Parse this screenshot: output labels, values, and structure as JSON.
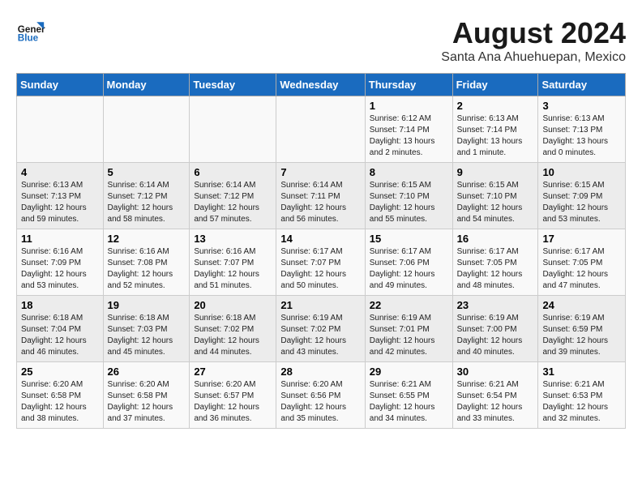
{
  "logo": {
    "line1": "General",
    "line2": "Blue"
  },
  "title": "August 2024",
  "subtitle": "Santa Ana Ahuehuepan, Mexico",
  "days_of_week": [
    "Sunday",
    "Monday",
    "Tuesday",
    "Wednesday",
    "Thursday",
    "Friday",
    "Saturday"
  ],
  "weeks": [
    [
      {
        "day": "",
        "sunrise": "",
        "sunset": "",
        "daylight": ""
      },
      {
        "day": "",
        "sunrise": "",
        "sunset": "",
        "daylight": ""
      },
      {
        "day": "",
        "sunrise": "",
        "sunset": "",
        "daylight": ""
      },
      {
        "day": "",
        "sunrise": "",
        "sunset": "",
        "daylight": ""
      },
      {
        "day": "1",
        "sunrise": "Sunrise: 6:12 AM",
        "sunset": "Sunset: 7:14 PM",
        "daylight": "Daylight: 13 hours and 2 minutes."
      },
      {
        "day": "2",
        "sunrise": "Sunrise: 6:13 AM",
        "sunset": "Sunset: 7:14 PM",
        "daylight": "Daylight: 13 hours and 1 minute."
      },
      {
        "day": "3",
        "sunrise": "Sunrise: 6:13 AM",
        "sunset": "Sunset: 7:13 PM",
        "daylight": "Daylight: 13 hours and 0 minutes."
      }
    ],
    [
      {
        "day": "4",
        "sunrise": "Sunrise: 6:13 AM",
        "sunset": "Sunset: 7:13 PM",
        "daylight": "Daylight: 12 hours and 59 minutes."
      },
      {
        "day": "5",
        "sunrise": "Sunrise: 6:14 AM",
        "sunset": "Sunset: 7:12 PM",
        "daylight": "Daylight: 12 hours and 58 minutes."
      },
      {
        "day": "6",
        "sunrise": "Sunrise: 6:14 AM",
        "sunset": "Sunset: 7:12 PM",
        "daylight": "Daylight: 12 hours and 57 minutes."
      },
      {
        "day": "7",
        "sunrise": "Sunrise: 6:14 AM",
        "sunset": "Sunset: 7:11 PM",
        "daylight": "Daylight: 12 hours and 56 minutes."
      },
      {
        "day": "8",
        "sunrise": "Sunrise: 6:15 AM",
        "sunset": "Sunset: 7:10 PM",
        "daylight": "Daylight: 12 hours and 55 minutes."
      },
      {
        "day": "9",
        "sunrise": "Sunrise: 6:15 AM",
        "sunset": "Sunset: 7:10 PM",
        "daylight": "Daylight: 12 hours and 54 minutes."
      },
      {
        "day": "10",
        "sunrise": "Sunrise: 6:15 AM",
        "sunset": "Sunset: 7:09 PM",
        "daylight": "Daylight: 12 hours and 53 minutes."
      }
    ],
    [
      {
        "day": "11",
        "sunrise": "Sunrise: 6:16 AM",
        "sunset": "Sunset: 7:09 PM",
        "daylight": "Daylight: 12 hours and 53 minutes."
      },
      {
        "day": "12",
        "sunrise": "Sunrise: 6:16 AM",
        "sunset": "Sunset: 7:08 PM",
        "daylight": "Daylight: 12 hours and 52 minutes."
      },
      {
        "day": "13",
        "sunrise": "Sunrise: 6:16 AM",
        "sunset": "Sunset: 7:07 PM",
        "daylight": "Daylight: 12 hours and 51 minutes."
      },
      {
        "day": "14",
        "sunrise": "Sunrise: 6:17 AM",
        "sunset": "Sunset: 7:07 PM",
        "daylight": "Daylight: 12 hours and 50 minutes."
      },
      {
        "day": "15",
        "sunrise": "Sunrise: 6:17 AM",
        "sunset": "Sunset: 7:06 PM",
        "daylight": "Daylight: 12 hours and 49 minutes."
      },
      {
        "day": "16",
        "sunrise": "Sunrise: 6:17 AM",
        "sunset": "Sunset: 7:05 PM",
        "daylight": "Daylight: 12 hours and 48 minutes."
      },
      {
        "day": "17",
        "sunrise": "Sunrise: 6:17 AM",
        "sunset": "Sunset: 7:05 PM",
        "daylight": "Daylight: 12 hours and 47 minutes."
      }
    ],
    [
      {
        "day": "18",
        "sunrise": "Sunrise: 6:18 AM",
        "sunset": "Sunset: 7:04 PM",
        "daylight": "Daylight: 12 hours and 46 minutes."
      },
      {
        "day": "19",
        "sunrise": "Sunrise: 6:18 AM",
        "sunset": "Sunset: 7:03 PM",
        "daylight": "Daylight: 12 hours and 45 minutes."
      },
      {
        "day": "20",
        "sunrise": "Sunrise: 6:18 AM",
        "sunset": "Sunset: 7:02 PM",
        "daylight": "Daylight: 12 hours and 44 minutes."
      },
      {
        "day": "21",
        "sunrise": "Sunrise: 6:19 AM",
        "sunset": "Sunset: 7:02 PM",
        "daylight": "Daylight: 12 hours and 43 minutes."
      },
      {
        "day": "22",
        "sunrise": "Sunrise: 6:19 AM",
        "sunset": "Sunset: 7:01 PM",
        "daylight": "Daylight: 12 hours and 42 minutes."
      },
      {
        "day": "23",
        "sunrise": "Sunrise: 6:19 AM",
        "sunset": "Sunset: 7:00 PM",
        "daylight": "Daylight: 12 hours and 40 minutes."
      },
      {
        "day": "24",
        "sunrise": "Sunrise: 6:19 AM",
        "sunset": "Sunset: 6:59 PM",
        "daylight": "Daylight: 12 hours and 39 minutes."
      }
    ],
    [
      {
        "day": "25",
        "sunrise": "Sunrise: 6:20 AM",
        "sunset": "Sunset: 6:58 PM",
        "daylight": "Daylight: 12 hours and 38 minutes."
      },
      {
        "day": "26",
        "sunrise": "Sunrise: 6:20 AM",
        "sunset": "Sunset: 6:58 PM",
        "daylight": "Daylight: 12 hours and 37 minutes."
      },
      {
        "day": "27",
        "sunrise": "Sunrise: 6:20 AM",
        "sunset": "Sunset: 6:57 PM",
        "daylight": "Daylight: 12 hours and 36 minutes."
      },
      {
        "day": "28",
        "sunrise": "Sunrise: 6:20 AM",
        "sunset": "Sunset: 6:56 PM",
        "daylight": "Daylight: 12 hours and 35 minutes."
      },
      {
        "day": "29",
        "sunrise": "Sunrise: 6:21 AM",
        "sunset": "Sunset: 6:55 PM",
        "daylight": "Daylight: 12 hours and 34 minutes."
      },
      {
        "day": "30",
        "sunrise": "Sunrise: 6:21 AM",
        "sunset": "Sunset: 6:54 PM",
        "daylight": "Daylight: 12 hours and 33 minutes."
      },
      {
        "day": "31",
        "sunrise": "Sunrise: 6:21 AM",
        "sunset": "Sunset: 6:53 PM",
        "daylight": "Daylight: 12 hours and 32 minutes."
      }
    ]
  ]
}
